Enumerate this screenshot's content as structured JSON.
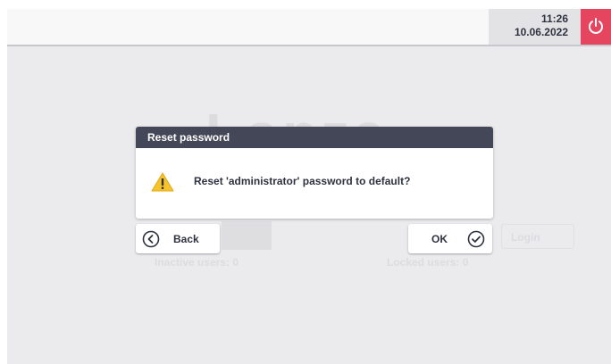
{
  "header": {
    "time": "11:26",
    "date": "10.06.2022",
    "power_icon": "power-icon",
    "power_color": "#e5455f"
  },
  "background": {
    "logo_text": "Lonza",
    "inactive_users": "Inactive users: 0",
    "locked_users": "Locked users: 0",
    "login_label": "Login"
  },
  "dialog": {
    "title": "Reset password",
    "message": "Reset 'administrator' password to default?",
    "icon": "warning-icon",
    "header_color": "#444757"
  },
  "buttons": {
    "back_label": "Back",
    "back_icon": "chevron-left-circle-icon",
    "ok_label": "OK",
    "ok_icon": "check-circle-icon"
  }
}
